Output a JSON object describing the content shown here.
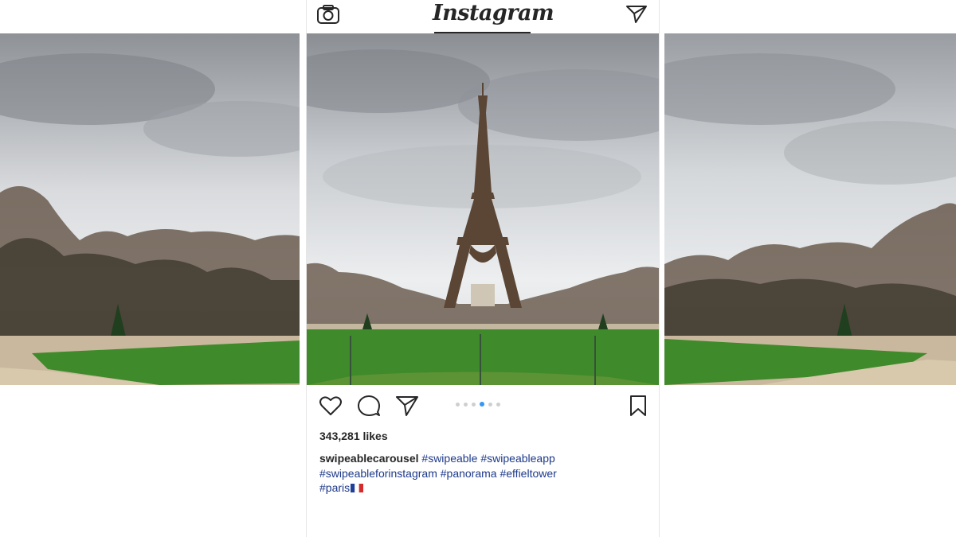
{
  "app": {
    "logo_text": "Instagram"
  },
  "topbar": {
    "camera_icon": "camera-icon",
    "send_icon": "direct-message-icon"
  },
  "post": {
    "photo_subject": "Eiffel Tower panorama over Champ de Mars",
    "carousel": {
      "total": 6,
      "active_index": 3
    },
    "likes_text": "343,281 likes",
    "caption": {
      "username": "swipeablecarousel",
      "line1_tags": [
        "#swipeable",
        "#swipeableapp"
      ],
      "line2_tags": [
        "#swipeableforinstagram",
        "#panorama",
        "#effieltower"
      ],
      "line3_tag": "#paris",
      "emoji": "french-flag-icon"
    }
  },
  "icons": {
    "like": "heart-icon",
    "comment": "comment-icon",
    "share": "share-icon",
    "save": "bookmark-icon"
  },
  "colors": {
    "text": "#262626",
    "hashtag": "#1e3a8a",
    "active_dot": "#3897f0",
    "inactive_dot": "#cfcfcf",
    "grass": "#3f8a2a",
    "sky": "#c9ccd0"
  }
}
